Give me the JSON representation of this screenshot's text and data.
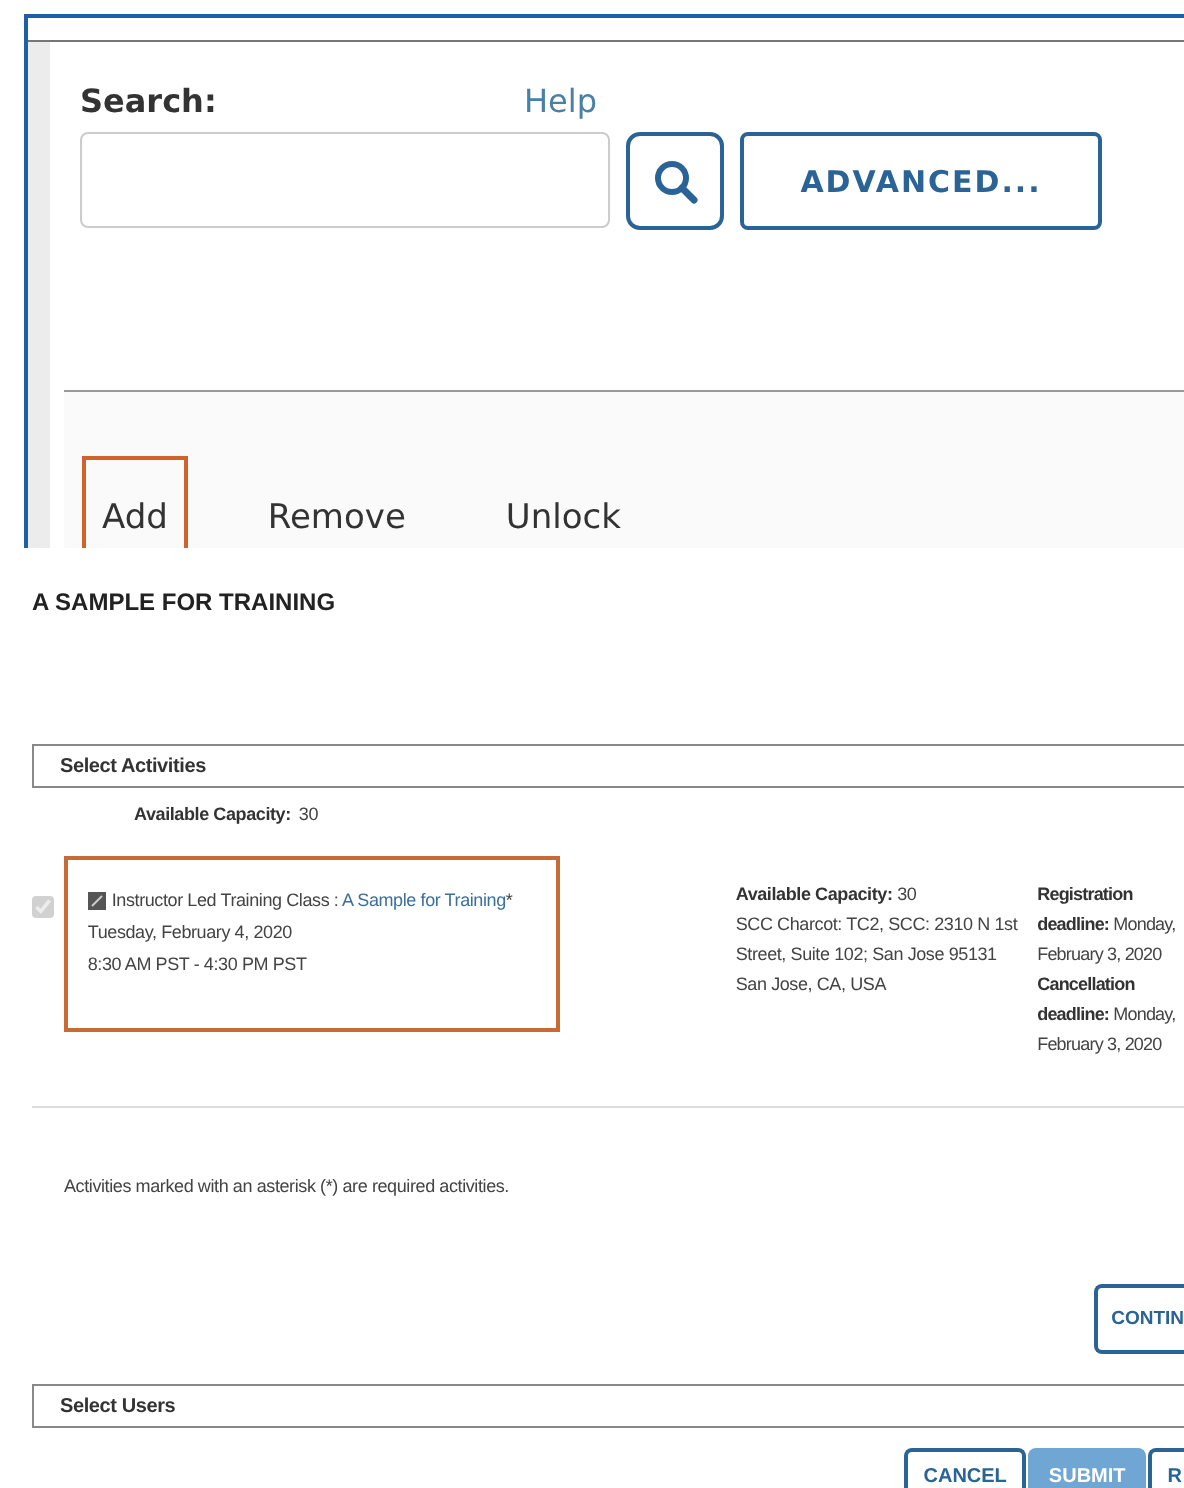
{
  "search_panel": {
    "label": "Search:",
    "help_link": "Help",
    "advanced_button": "ADVANCED..."
  },
  "tabs": [
    {
      "label": "Add",
      "highlighted": true
    },
    {
      "label": "Remove",
      "highlighted": false
    },
    {
      "label": "Unlock",
      "highlighted": false
    }
  ],
  "page_title": "A SAMPLE FOR TRAINING",
  "select_activities": {
    "header": "Select Activities",
    "capacity_label": "Available Capacity:",
    "capacity_value": "30",
    "activities": [
      {
        "checked": true,
        "disabled": true,
        "highlighted": true,
        "type": "Instructor Led Training Class :",
        "name": "A Sample for Training",
        "required_mark": "*",
        "date": "Tuesday, February 4, 2020",
        "time": "8:30 AM PST - 4:30 PM PST",
        "capacity": "**Available Capacity:** 30",
        "location": "SCC Charcot: TC2, SCC: 2310 N 1st Street, Suite 102; San Jose 95131",
        "city": "San Jose, CA, USA",
        "registration": "**Registration deadline:** Monday, February 3, 2020",
        "cancellation": "**Cancellation deadline:** Monday, February 3, 2020"
      }
    ],
    "note": "Activities marked with an asterisk (*) are required activities.",
    "continue_button": "CONTIN"
  },
  "select_users": {
    "header": "Select Users"
  },
  "buttons": [
    {
      "label": "CANCEL",
      "kind": "secondary"
    },
    {
      "label": "SUBMIT",
      "kind": "primary"
    },
    {
      "label": "R",
      "kind": "secondary"
    }
  ]
}
